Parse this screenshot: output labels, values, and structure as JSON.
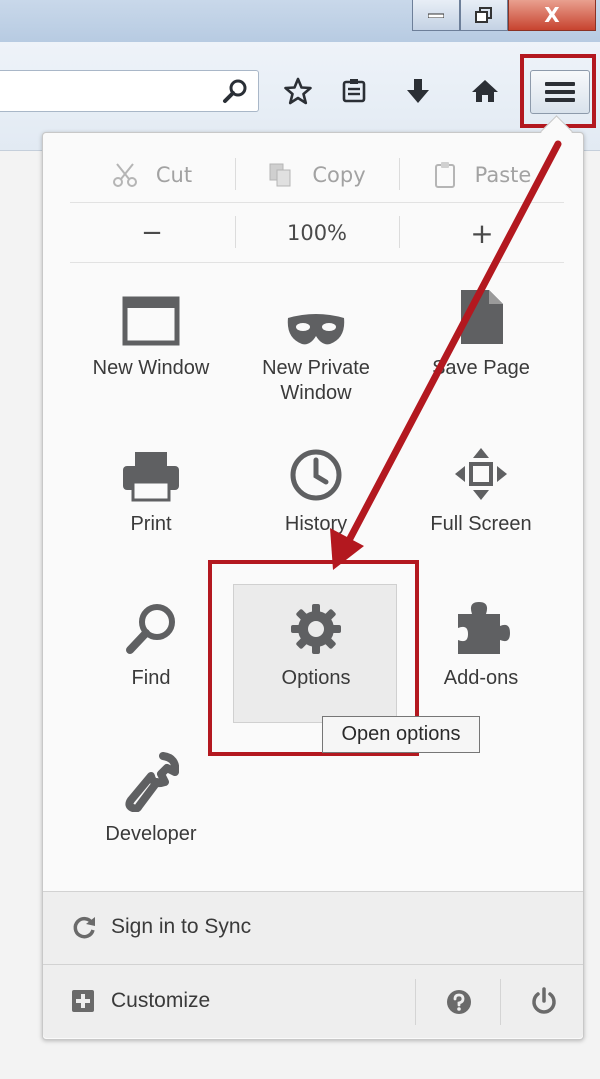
{
  "window": {
    "minimize_icon": "minimize-icon",
    "restore_icon": "restore-icon",
    "close_label": "X"
  },
  "toolbar": {
    "icons": [
      "search-icon",
      "bookmark-star-icon",
      "reading-list-icon",
      "download-arrow-icon",
      "home-icon",
      "hamburger-menu-icon"
    ]
  },
  "edit_row": {
    "cut": "Cut",
    "copy": "Copy",
    "paste": "Paste"
  },
  "zoom_row": {
    "zoom_out": "−",
    "zoom_level": "100%",
    "zoom_in": "+"
  },
  "tiles": {
    "new_window": "New Window",
    "new_private_window_l1": "New Private",
    "new_private_window_l2": "Window",
    "save_page": "Save Page",
    "print": "Print",
    "history": "History",
    "full_screen": "Full Screen",
    "find": "Find",
    "options": "Options",
    "add_ons": "Add-ons",
    "developer": "Developer"
  },
  "tooltip": "Open options",
  "footer": {
    "sync": "Sign in to Sync",
    "customize": "Customize"
  },
  "colors": {
    "highlight": "#b3181f",
    "panel_bg": "#fafafa",
    "icon_gray": "#5f6062"
  }
}
